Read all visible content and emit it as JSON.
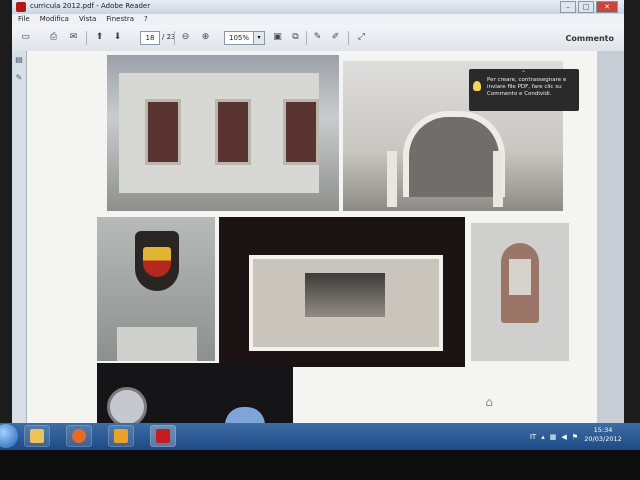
{
  "window": {
    "title": "curricula 2012.pdf - Adobe Reader",
    "controls": [
      "–",
      "□",
      "✕"
    ]
  },
  "menubar": [
    "File",
    "Modifica",
    "Vista",
    "Finestra",
    "?"
  ],
  "toolbar": {
    "page_current": "18",
    "page_total": "/ 23",
    "zoom": "105%",
    "comment_label": "Commento"
  },
  "tooltip": {
    "text": "Per creare, contrassegnare e inviare file PDF, fare clic su Commento e Condividi."
  },
  "taskbar": {
    "apps": [
      "explorer",
      "media-player",
      "outlook",
      "adobe-reader"
    ],
    "lang": "IT",
    "time": "15:34",
    "date": "20/03/2012"
  },
  "colors": {
    "taskbar": "#1d4a85",
    "titlebar": "#c9d4e2",
    "reader_red": "#b31616",
    "tooltip_bg": "#2a2a2a"
  }
}
